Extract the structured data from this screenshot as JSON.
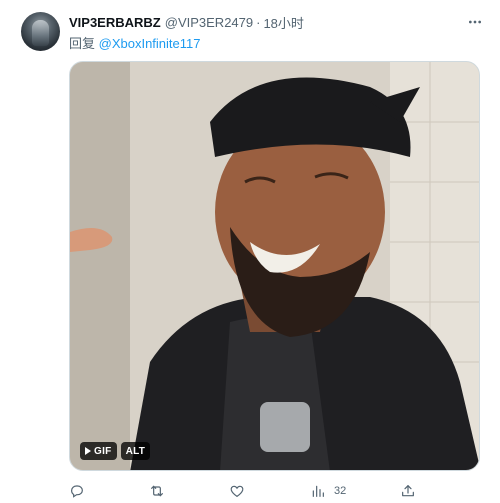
{
  "tweet": {
    "display_name": "VIP3ERBARBZ",
    "handle": "@VIP3ER2479",
    "separator": "·",
    "time": "18小时",
    "reply_prefix": "回复",
    "reply_to": "@XboxInfinite117"
  },
  "media": {
    "badges": [
      "GIF",
      "ALT"
    ]
  },
  "actions": {
    "views_count": "32"
  },
  "icons": {
    "more": "more-horizontal-icon",
    "reply": "comment-icon",
    "retweet": "retweet-icon",
    "like": "heart-icon",
    "views": "bar-chart-icon",
    "share": "share-icon"
  },
  "colors": {
    "accent": "#1d9bf0",
    "secondary_text": "#536471",
    "primary_text": "#0f1419"
  }
}
